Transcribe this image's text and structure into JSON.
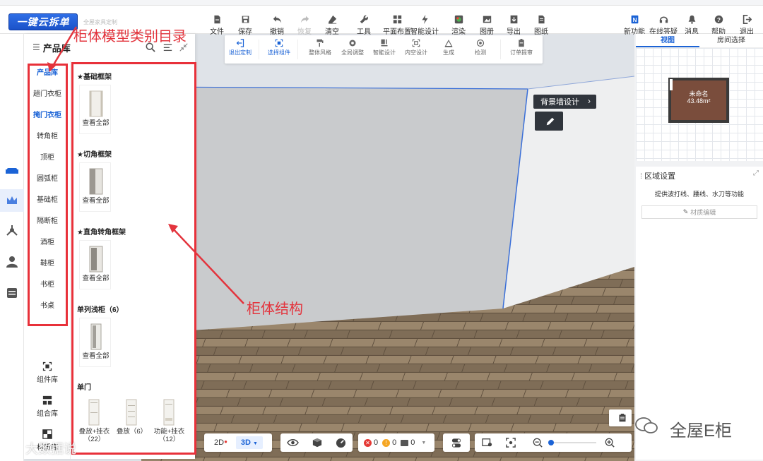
{
  "header": {
    "logo": "一键云拆单",
    "logo_sub": "全屋家具定制",
    "tools": [
      {
        "label": "文件",
        "icon": "file-icon"
      },
      {
        "label": "保存",
        "icon": "save-icon"
      },
      {
        "label": "撤销",
        "icon": "undo-icon"
      },
      {
        "label": "恢复",
        "icon": "redo-icon"
      },
      {
        "label": "清空",
        "icon": "eraser-icon"
      },
      {
        "label": "工具",
        "icon": "wrench-icon"
      },
      {
        "label": "平面布置",
        "icon": "floorplan-icon"
      },
      {
        "label": "智能设计",
        "icon": "lightning-icon"
      },
      {
        "label": "渲染",
        "icon": "render-icon"
      },
      {
        "label": "图册",
        "icon": "album-icon"
      },
      {
        "label": "导出",
        "icon": "export-icon"
      },
      {
        "label": "图纸",
        "icon": "drawing-icon"
      }
    ],
    "right_tools": [
      {
        "label": "新功能",
        "icon": "new-feature-icon"
      },
      {
        "label": "在线答疑",
        "icon": "headset-icon"
      },
      {
        "label": "消息",
        "icon": "bell-icon"
      },
      {
        "label": "帮助",
        "icon": "help-icon"
      },
      {
        "label": "退出",
        "icon": "logout-icon"
      }
    ]
  },
  "float_toolbar": {
    "items": [
      {
        "label": "退出定制",
        "icon": "exit-custom-icon",
        "active": true
      },
      {
        "label": "选择组件",
        "icon": "select-component-icon",
        "active": true
      },
      {
        "label": "整体风格",
        "icon": "style-icon"
      },
      {
        "label": "全局调整",
        "icon": "global-adjust-icon"
      },
      {
        "label": "智能设计",
        "icon": "smart-design-icon"
      },
      {
        "label": "内空设计",
        "icon": "inner-space-icon"
      },
      {
        "label": "生成",
        "icon": "generate-icon"
      },
      {
        "label": "检测",
        "icon": "check-icon"
      },
      {
        "label": "订单提审",
        "icon": "order-icon"
      }
    ]
  },
  "panel": {
    "title": "产品库",
    "tab_label": "产品库",
    "categories": [
      "趟门衣柜",
      "掩门衣柜",
      "转角柜",
      "顶柜",
      "圆弧柜",
      "基础柜",
      "隔断柜",
      "酒柜",
      "鞋柜",
      "书柜",
      "书桌"
    ],
    "active_category": "掩门衣柜",
    "bottom_nav": [
      {
        "label": "组件库",
        "icon": "component-lib-icon"
      },
      {
        "label": "组合库",
        "icon": "combo-lib-icon"
      },
      {
        "label": "材质库",
        "icon": "material-lib-icon"
      }
    ],
    "sections": [
      {
        "title": "★基础框架",
        "items": [
          {
            "label": "查看全部"
          }
        ]
      },
      {
        "title": "★切角框架",
        "items": [
          {
            "label": "查看全部"
          }
        ]
      },
      {
        "title": "★直角转角框架",
        "items": [
          {
            "label": "查看全部"
          }
        ]
      },
      {
        "title": "单列浅柜（6）",
        "items": [
          {
            "label": "查看全部"
          }
        ]
      },
      {
        "title": "单门",
        "items": [
          {
            "label": "叠放+挂衣（22）"
          },
          {
            "label": "叠放（6）"
          },
          {
            "label": "功能+挂衣（12）"
          }
        ]
      }
    ]
  },
  "canvas": {
    "wall_design_label": "背景墙设计"
  },
  "right_panel": {
    "tabs": [
      "视图",
      "房间选择"
    ],
    "active_tab": "视图",
    "room_name": "未命名",
    "room_area": "43.48m²",
    "area_title": "区域设置",
    "area_desc": "提供波打线、腰线、水刀等功能",
    "material_edit": "材质编辑"
  },
  "bottom_toolbar": {
    "mode_2d": "2D",
    "mode_3d": "3D",
    "errors": "0",
    "warnings": "0",
    "infos": "0"
  },
  "annotations": {
    "category_label": "柜体模型类别目录",
    "structure_label": "柜体结构"
  },
  "watermarks": {
    "left": "大数据说",
    "right": "全屋E柜"
  },
  "colors": {
    "brand_blue": "#1b63d6",
    "annotation_red": "#e3343d",
    "floor_wood": "#8a7760",
    "wall_gray": "#c9cbcd"
  }
}
